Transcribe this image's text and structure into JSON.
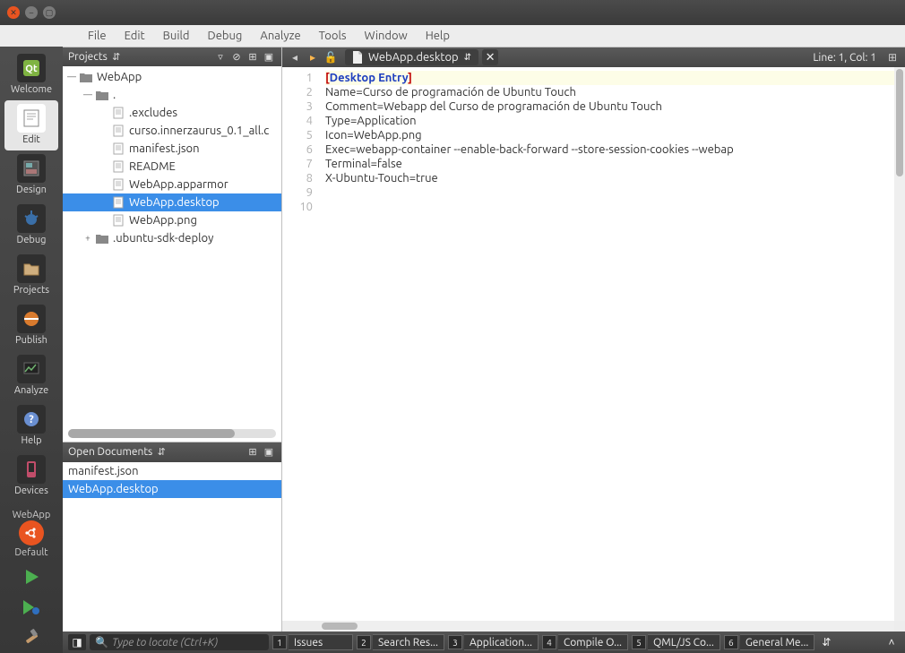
{
  "menus": [
    "File",
    "Edit",
    "Build",
    "Debug",
    "Analyze",
    "Tools",
    "Window",
    "Help"
  ],
  "modes": [
    {
      "id": "welcome",
      "label": "Welcome"
    },
    {
      "id": "edit",
      "label": "Edit"
    },
    {
      "id": "design",
      "label": "Design"
    },
    {
      "id": "debug",
      "label": "Debug"
    },
    {
      "id": "projects",
      "label": "Projects"
    },
    {
      "id": "publish",
      "label": "Publish"
    },
    {
      "id": "analyze",
      "label": "Analyze"
    },
    {
      "id": "help",
      "label": "Help"
    },
    {
      "id": "devices",
      "label": "Devices"
    }
  ],
  "active_mode": "edit",
  "kit": {
    "project": "WebApp",
    "name": "Default"
  },
  "projects_panel": {
    "title": "Projects",
    "root": "WebApp",
    "dot_folder": ".",
    "files": [
      ".excludes",
      "curso.innerzaurus_0.1_all.c",
      "manifest.json",
      "README",
      "WebApp.apparmor",
      "WebApp.desktop",
      "WebApp.png"
    ],
    "selected_file": "WebApp.desktop",
    "deploy_folder": ".ubuntu-sdk-deploy"
  },
  "open_documents": {
    "title": "Open Documents",
    "items": [
      "manifest.json",
      "WebApp.desktop"
    ],
    "selected": "WebApp.desktop"
  },
  "editor": {
    "filename": "WebApp.desktop",
    "line_col": "Line: 1, Col: 1",
    "lines": [
      {
        "type": "header",
        "open": "[",
        "kw": "Desktop Entry",
        "close": "]"
      },
      {
        "type": "plain",
        "text": "Name=Curso de programación de Ubuntu Touch"
      },
      {
        "type": "plain",
        "text": "Comment=Webapp del Curso de programación de Ubuntu Touch"
      },
      {
        "type": "plain",
        "text": "Type=Application"
      },
      {
        "type": "plain",
        "text": "Icon=WebApp.png"
      },
      {
        "type": "plain",
        "text": "Exec=webapp-container --enable-back-forward --store-session-cookies --webap"
      },
      {
        "type": "plain",
        "text": "Terminal=false"
      },
      {
        "type": "plain",
        "text": "X-Ubuntu-Touch=true"
      },
      {
        "type": "plain",
        "text": ""
      },
      {
        "type": "plain",
        "text": ""
      }
    ]
  },
  "locator_placeholder": "Type to locate (Ctrl+K)",
  "status_panes": [
    {
      "num": "1",
      "label": "Issues"
    },
    {
      "num": "2",
      "label": "Search Res..."
    },
    {
      "num": "3",
      "label": "Application..."
    },
    {
      "num": "4",
      "label": "Compile O..."
    },
    {
      "num": "5",
      "label": "QML/JS Co..."
    },
    {
      "num": "6",
      "label": "General Me..."
    }
  ]
}
